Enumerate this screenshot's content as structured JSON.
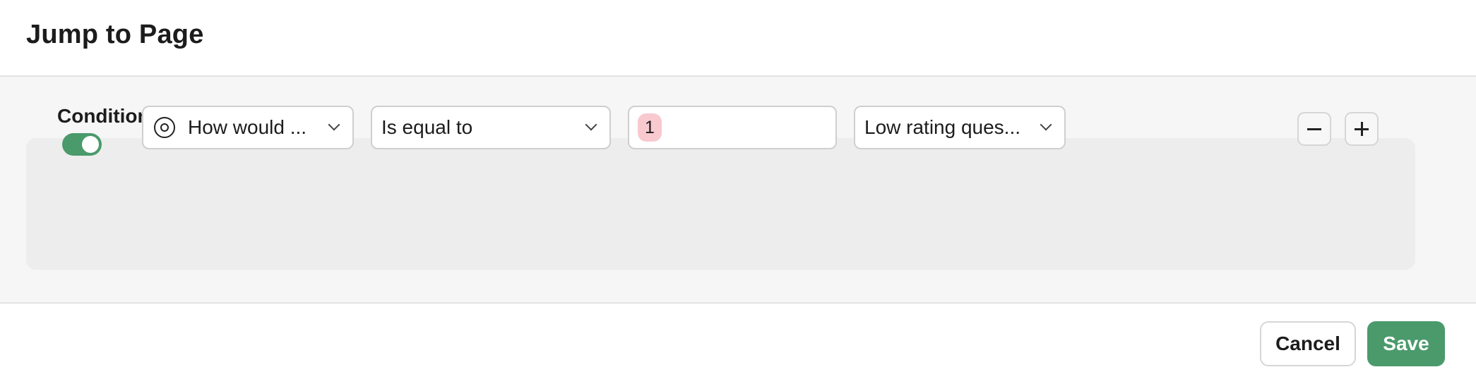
{
  "dialog": {
    "title": "Jump to Page"
  },
  "conditionals": {
    "section_title": "Conditionals",
    "rule": {
      "enabled": true,
      "question_label": "How would ...",
      "question_icon": "target-icon",
      "operator_label": "Is equal to",
      "value": "1",
      "target_page_label": "Low rating ques..."
    }
  },
  "footer": {
    "cancel_label": "Cancel",
    "save_label": "Save"
  },
  "colors": {
    "accent": "#4a9a6c",
    "value_pill": "#f8c9cf",
    "panel_bg": "#ededed",
    "body_bg": "#f6f6f6"
  }
}
